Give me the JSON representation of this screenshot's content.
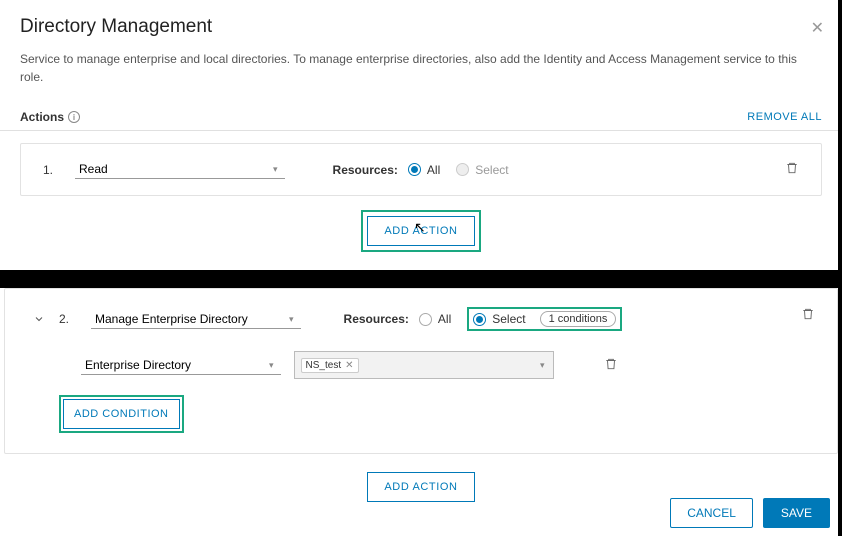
{
  "header": {
    "title": "Directory Management",
    "subtitle": "Service to manage enterprise and local directories. To manage enterprise directories, also add the Identity and Access Management service to this role."
  },
  "actions_row": {
    "label": "Actions",
    "remove_all": "REMOVE ALL"
  },
  "action1": {
    "index": "1.",
    "value": "Read",
    "resources_label": "Resources:",
    "all_label": "All",
    "select_label": "Select"
  },
  "add_action": "ADD ACTION",
  "action2": {
    "index": "2.",
    "value": "Manage Enterprise Directory",
    "resources_label": "Resources:",
    "all_label": "All",
    "select_label": "Select",
    "conditions_pill": "1 conditions",
    "condition_type": "Enterprise Directory",
    "condition_tag": "NS_test",
    "add_condition": "ADD CONDITION"
  },
  "add_action2": "ADD ACTION",
  "footer": {
    "cancel": "CANCEL",
    "save": "SAVE"
  }
}
